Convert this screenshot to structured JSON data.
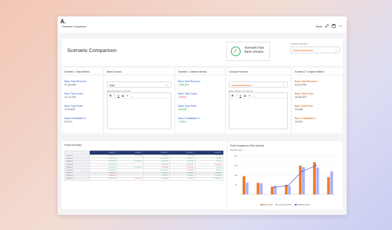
{
  "app": {
    "logo": "A.",
    "breadcrumb_back": "‹",
    "breadcrumb": "Scenario Comparison",
    "reset": "Reset",
    "page_title": "Scenario Comparison"
  },
  "banner": {
    "message_line1": "Scenario has",
    "message_line2": "been chosen."
  },
  "compare_select": {
    "label": "Compare Scenario",
    "value": "Environmental Scen"
  },
  "base_metrics": {
    "title": "Scenario 1: Base Metrics",
    "items": [
      {
        "label": "Base Total Revenue:",
        "value": "91,253,963"
      },
      {
        "label": "Base Total Costs:",
        "value": "31,112,063"
      },
      {
        "label": "Base Total Profit:",
        "value": "3,253,598"
      },
      {
        "label": "Base Profitability %:",
        "value": "25.91%"
      }
    ]
  },
  "base_scenario": {
    "title": "Base Scenario",
    "select_value": "Base",
    "comments_label": "Base Scenario Comments"
  },
  "variance_metrics": {
    "title": "Scenario 1: Variance Metrics",
    "items": [
      {
        "label": "Base Total Revenue:",
        "value": "1,555,363"
      },
      {
        "label": "Base Total Costs:",
        "value": "725,511"
      },
      {
        "label": "Base Total Profit:",
        "value": "253,898"
      },
      {
        "label": "Base Profitability %:",
        "value": "0.259%"
      }
    ]
  },
  "compare_scenario": {
    "title": "Compare Scenario",
    "select_value": "Environmental Scen",
    "comments_label": "Base Scenario Comments"
  },
  "compare_metrics": {
    "title": "Scenario 2: Compare Metrics",
    "items": [
      {
        "label": "Base Total Revenue:",
        "value": "83,213,336"
      },
      {
        "label": "Base Total Costs:",
        "value": "38,983,523"
      },
      {
        "label": "Base Total Profit:",
        "value": "324,883"
      },
      {
        "label": "Base Profitability %:",
        "value": "28.36%"
      }
    ]
  },
  "editor": {
    "bold": "B",
    "italic": "I",
    "underline": "U",
    "strike": "S",
    "list": "≡·",
    "chev": "⌄"
  },
  "project_summary": {
    "title": "Project Summary",
    "headers": [
      "",
      "Location 1",
      "Location 2",
      "Location 3",
      "Location 4",
      "Location 5"
    ],
    "rows": [
      {
        "label": "Product 1",
        "cells": [
          "$ 456,077",
          "$ 182,388",
          "$ 9,520",
          "$ 0,538",
          "$ 2,548"
        ],
        "neg": [
          false,
          false,
          false,
          false,
          false
        ],
        "hl": false
      },
      {
        "label": "Product 2",
        "cells": [
          "$ 125,163",
          "",
          "$ 1,266,19",
          "$ 283,33",
          "$ 2,456"
        ],
        "neg": [
          false,
          false,
          false,
          false,
          false
        ],
        "hl": false
      },
      {
        "label": "Product 3",
        "cells": [
          "$ 213,965",
          "$ 3,252,83",
          "$ 32,555",
          "$ 250,93",
          "$ 2,525"
        ],
        "neg": [
          false,
          false,
          false,
          false,
          false
        ],
        "hl": false
      },
      {
        "label": "Product 4",
        "cells": [
          "$ 1,252,96",
          "",
          "$ 82,858",
          "$ 322,533",
          "$ 4,48,00"
        ],
        "neg": [
          false,
          false,
          false,
          false,
          true
        ],
        "hl": false
      },
      {
        "label": "Product 5",
        "cells": [
          "$ 31,0520",
          "$ 3,205,53",
          "$ 28,538",
          "$ 12,035",
          "$ 0,258"
        ],
        "neg": [
          false,
          false,
          true,
          true,
          false
        ],
        "hl": false
      },
      {
        "label": "Product 6",
        "cells": [
          "$ 1,2528,00",
          "",
          "$ 1,52,380",
          "$ 33,625",
          "$ 25,85"
        ],
        "neg": [
          false,
          false,
          false,
          true,
          false
        ],
        "hl": false
      },
      {
        "label": "Product 7",
        "cells": [
          "$ -525,003",
          "",
          "$ 6,3356",
          "$ 35,256",
          "$ 3,5320"
        ],
        "neg": [
          true,
          false,
          false,
          false,
          false
        ],
        "hl": true
      },
      {
        "label": "Product 8",
        "cells": [
          "$ 268,527",
          "",
          "$ 62,595",
          "$ 2,0885",
          "$ 28,3521"
        ],
        "neg": [
          true,
          false,
          false,
          false,
          false
        ],
        "hl": false
      },
      {
        "label": "Product 9",
        "cells": [
          "$ -123,618",
          "$ -152,221",
          "$ -55,826",
          "$ 2,5355",
          "$ 1,203,531"
        ],
        "neg": [
          true,
          true,
          true,
          false,
          false
        ],
        "hl": false
      }
    ]
  },
  "profit_chart": {
    "title": "Profit Comparison (Filter Specific)",
    "filter_label": "Product Type",
    "filter_chev": "⌄",
    "y_ticks": [
      "200",
      "150",
      "100",
      "50"
    ],
    "legend": [
      "Base Profit",
      "Compare Profit",
      "Variance Profit"
    ]
  },
  "chart_data": {
    "type": "bar",
    "categories": [
      "1",
      "2",
      "3",
      "4",
      "5",
      "6",
      "7"
    ],
    "ylim": [
      0,
      200
    ],
    "series": [
      {
        "name": "Base Profit",
        "type": "bar",
        "values": [
          95,
          60,
          40,
          50,
          150,
          168,
          90
        ]
      },
      {
        "name": "Compare Profit",
        "type": "bar",
        "values": [
          62,
          58,
          45,
          44,
          142,
          140,
          120
        ]
      },
      {
        "name": "Variance Profit",
        "type": "line",
        "values": [
          null,
          null,
          38,
          45,
          120,
          150,
          null
        ]
      }
    ],
    "colors": {
      "base": "#f07a2a",
      "compare": "#a9b1f5",
      "variance": "#5b62d6"
    }
  }
}
